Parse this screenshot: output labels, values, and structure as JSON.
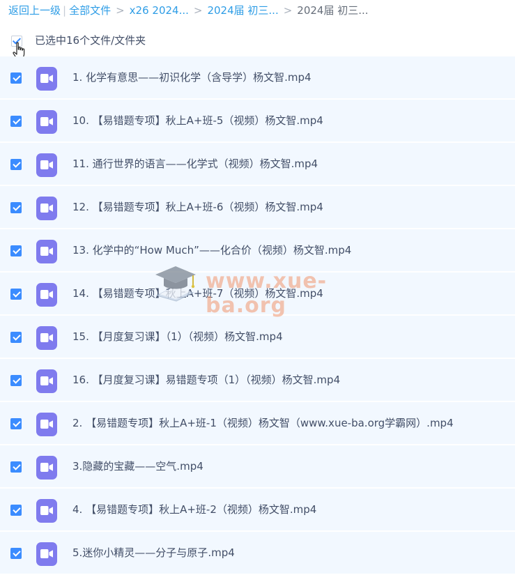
{
  "breadcrumb": {
    "back": "返回上一级",
    "separator_bar": "|",
    "separator": ">",
    "crumbs": [
      "全部文件",
      "x26 2024...",
      "2024届 初三..."
    ],
    "current": "2024届 初三..."
  },
  "selection": {
    "text": "已选中16个文件/文件夹",
    "all_checked": true
  },
  "files": [
    {
      "name": "1. 化学有意思——初识化学（含导学）杨文智.mp4",
      "checked": true,
      "icon": "video-file-icon"
    },
    {
      "name": "10. 【易错题专项】秋上A+班-5（视频）杨文智.mp4",
      "checked": true,
      "icon": "video-file-icon"
    },
    {
      "name": "11. 通行世界的语言——化学式（视频）杨文智.mp4",
      "checked": true,
      "icon": "video-file-icon"
    },
    {
      "name": "12. 【易错题专项】秋上A+班-6（视频）杨文智.mp4",
      "checked": true,
      "icon": "video-file-icon"
    },
    {
      "name": "13. 化学中的“How Much”——化合价（视频）杨文智.mp4",
      "checked": true,
      "icon": "video-file-icon"
    },
    {
      "name": "14. 【易错题专项】秋上A+班-7（视频）杨文智.mp4",
      "checked": true,
      "icon": "video-file-icon"
    },
    {
      "name": "15. 【月度复习课】（1）（视频）杨文智.mp4",
      "checked": true,
      "icon": "video-file-icon"
    },
    {
      "name": "16. 【月度复习课】易错题专项（1）（视频）杨文智.mp4",
      "checked": true,
      "icon": "video-file-icon"
    },
    {
      "name": "2. 【易错题专项】秋上A+班-1（视频）杨文智（www.xue-ba.org学霸网）.mp4",
      "checked": true,
      "icon": "video-file-icon"
    },
    {
      "name": "3.隐藏的宝藏——空气.mp4",
      "checked": true,
      "icon": "video-file-icon"
    },
    {
      "name": "4. 【易错题专项】秋上A+班-2（视频）杨文智.mp4",
      "checked": true,
      "icon": "video-file-icon"
    },
    {
      "name": "5.迷你小精灵——分子与原子.mp4",
      "checked": true,
      "icon": "video-file-icon"
    }
  ],
  "watermark": {
    "text": "www.xue-ba.org"
  },
  "colors": {
    "accent": "#3b8cff",
    "link": "#2e9de6",
    "row_bg": "#f2f8ff",
    "video_icon": "#7f7bee"
  }
}
